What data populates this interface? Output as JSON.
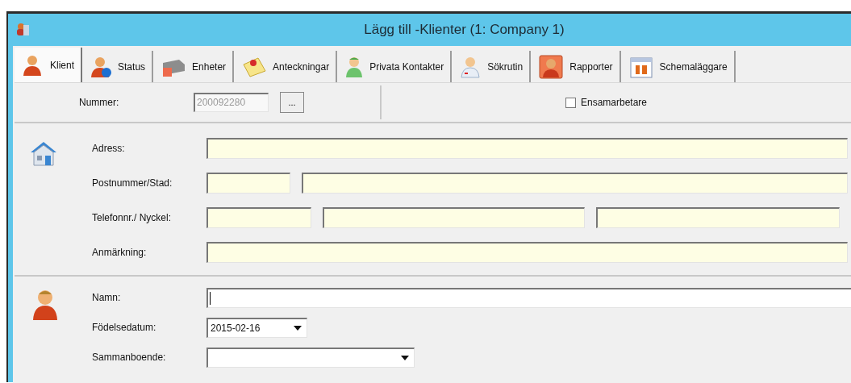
{
  "window": {
    "title": "Lägg till -Klienter (1: Company 1)"
  },
  "tabs": [
    {
      "label": "Klient",
      "selected": true
    },
    {
      "label": "Status",
      "selected": false
    },
    {
      "label": "Enheter",
      "selected": false
    },
    {
      "label": "Anteckningar",
      "selected": false
    },
    {
      "label": "Privata Kontakter",
      "selected": false
    },
    {
      "label": "Sökrutin",
      "selected": false
    },
    {
      "label": "Rapporter",
      "selected": false
    },
    {
      "label": "Schemaläggare",
      "selected": false
    }
  ],
  "number_row": {
    "label": "Nummer:",
    "value": "200092280",
    "disabled": true,
    "button": "...",
    "checkbox": {
      "label": "Ensamarbetare",
      "checked": false
    }
  },
  "address_section": [
    {
      "label": "Adress:",
      "fields": [
        {
          "required": true
        }
      ]
    },
    {
      "label": "Postnummer/Stad:",
      "fields": [
        {
          "required": true
        },
        {
          "required": true
        }
      ]
    },
    {
      "label": "Telefonnr./ Nyckel:",
      "fields": [
        {
          "required": true
        },
        {
          "required": true
        },
        {
          "required": true
        }
      ]
    },
    {
      "label": "Anmärkning:",
      "fields": [
        {
          "required": true
        }
      ]
    }
  ],
  "person_section": [
    {
      "label": "Namn:",
      "kind": "text",
      "focused": true
    },
    {
      "label": "Födelsedatum:",
      "kind": "date",
      "value": "2015-02-16"
    },
    {
      "label": "Sammanboende:",
      "kind": "dropdown"
    }
  ]
}
